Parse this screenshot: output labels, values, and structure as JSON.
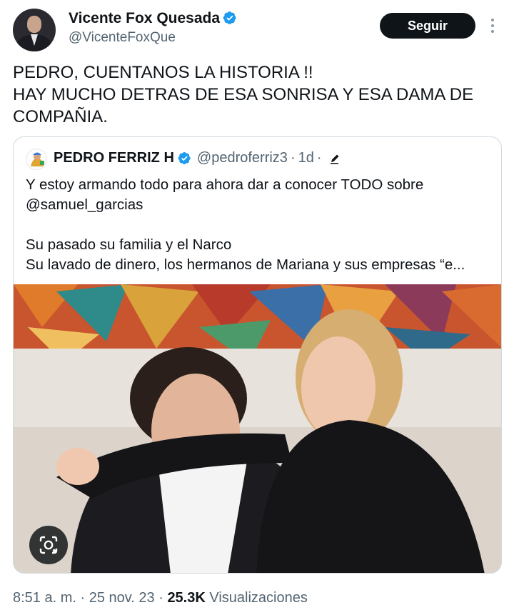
{
  "author": {
    "name": "Vicente Fox Quesada",
    "handle": "@VicenteFoxQue"
  },
  "follow_label": "Seguir",
  "tweet": {
    "lines": [
      "PEDRO, CUENTANOS LA HISTORIA !!",
      "HAY MUCHO DETRAS DE ESA SONRISA Y ESA DAMA DE",
      "COMPAÑIA."
    ]
  },
  "quoted": {
    "name": "PEDRO FERRIZ H",
    "handle": "@pedroferriz3",
    "time": "1d",
    "lines": [
      "Y estoy armando todo para ahora dar a conocer TODO sobre",
      "@samuel_garcias",
      "Su pasado su familia y  el Narco",
      "Su lavado de dinero, los hermanos de Mariana y sus empresas “e..."
    ]
  },
  "meta": {
    "time": "8:51 a. m.",
    "date": "25 nov. 23",
    "views_count": "25.3K",
    "views_label": "Visualizaciones"
  },
  "colors": {
    "verified": "#1d9bf0",
    "button_bg": "#0f1419",
    "secondary_text": "#536471"
  },
  "icons": [
    "verified-badge-icon",
    "more-options-icon",
    "edit-pencil-icon",
    "google-lens-icon"
  ]
}
